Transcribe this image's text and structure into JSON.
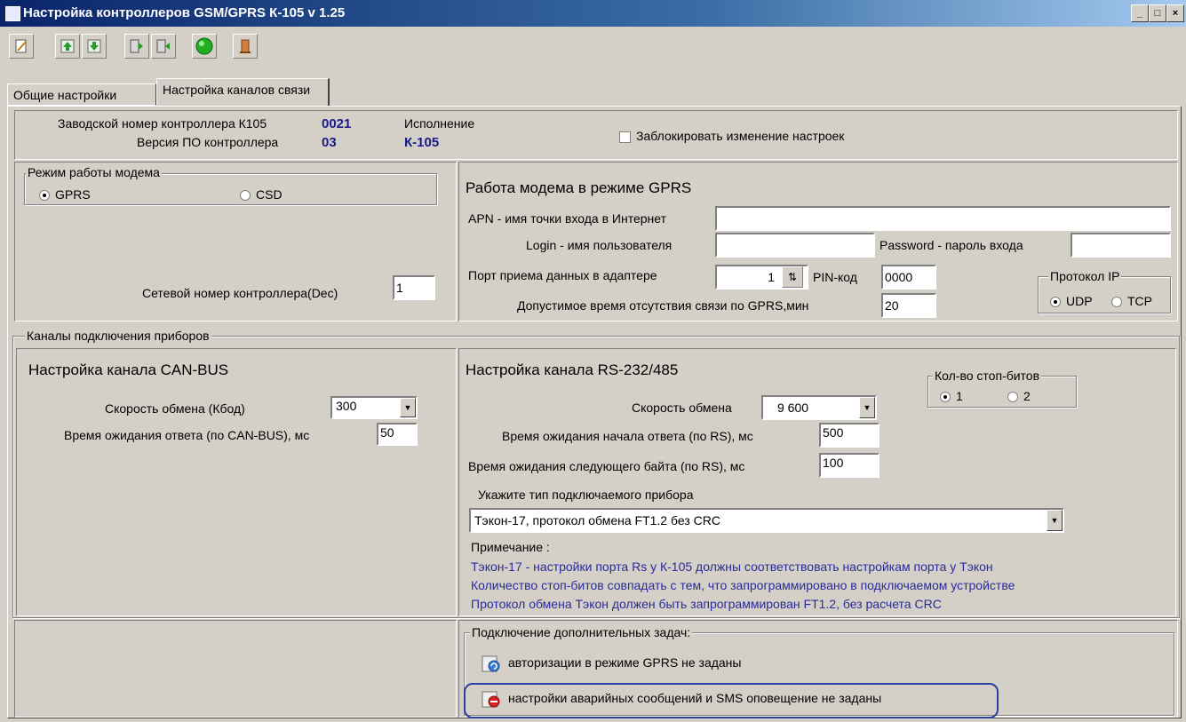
{
  "window": {
    "title": "Настройка контроллеров GSM/GPRS К-105   v 1.25",
    "buttons": [
      "_",
      "□",
      "×"
    ]
  },
  "toolbar": {
    "icons": [
      "edit-icon",
      "arrow-up-icon",
      "arrow-down-icon",
      "read-device-icon",
      "write-device-icon",
      "connect-status-icon",
      "exit-icon"
    ]
  },
  "tabs": [
    {
      "label": "Общие настройки",
      "active": false
    },
    {
      "label": "Настройка каналов связи",
      "active": true
    }
  ],
  "header": {
    "serial_label": "Заводской номер контроллера К105",
    "serial_value": "0021",
    "fw_label": "Версия ПО контроллера",
    "fw_value": "03",
    "variant_label": "Исполнение",
    "variant_value": "К-105",
    "lock_label": "Заблокировать изменение настроек",
    "lock_checked": false
  },
  "modem_mode": {
    "group_label": "Режим работы модема",
    "options": [
      "GPRS",
      "CSD"
    ],
    "selected": "GPRS",
    "net_number_label": "Сетевой номер контроллера(Dec)",
    "net_number_value": "1"
  },
  "gprs": {
    "title": "Работа модема в режиме GPRS",
    "apn_label": "APN - имя точки входа в Интернет",
    "apn_value": "",
    "login_label": "Login - имя пользователя",
    "login_value": "",
    "password_label": "Password  - пароль входа",
    "password_value": "",
    "port_label": "Порт приема данных в адаптере",
    "port_value": "1",
    "pin_label": "PIN-код",
    "pin_value": "0000",
    "timeout_label": "Допустимое время отсутствия связи по GPRS,мин",
    "timeout_value": "20",
    "protocol_group_label": "Протокол IP",
    "protocol_options": [
      "UDP",
      "TCP"
    ],
    "protocol_selected": "UDP"
  },
  "channels": {
    "group_label": "Каналы подключения приборов",
    "can": {
      "title": "Настройка  канала CAN-BUS",
      "speed_label": "Скорость обмена (Кбод)",
      "speed_value": "300",
      "timeout_label": "Время ожидания ответа (по CAN-BUS), мс",
      "timeout_value": "50"
    },
    "rs": {
      "title": "Настройка канала RS-232/485",
      "stopbits_group_label": "Кол-во стоп-битов",
      "stopbits_options": [
        "1",
        "2"
      ],
      "stopbits_selected": "1",
      "speed_label": "Скорость обмена",
      "speed_value": "9 600",
      "start_timeout_label": "Время ожидания начала ответа (по RS), мс",
      "start_timeout_value": "500",
      "byte_timeout_label": "Время ожидания следующего байта (по RS), мс",
      "byte_timeout_value": "100",
      "device_type_label": "Укажите тип подключаемого прибора",
      "device_type_value": "Тэкон-17, протокол обмена FT1.2 без CRC",
      "note_label": "Примечание :",
      "notes": [
        "Тэкон-17 - настройки порта Rs у К-105 должны соответствовать настройкам порта у Тэкон",
        "Количество стоп-битов совпадать с тем, что запрограммировано в подключаемом устройстве",
        "Протокол обмена Тэкон должен быть запрограммирован FT1.2, без расчета CRC"
      ]
    }
  },
  "extra_tasks": {
    "group_label": "Подключение дополнительных задач:",
    "auth_label": "авторизации в режиме GPRS не заданы",
    "alarm_label": "настройки аварийных сообщений и SMS оповещение не заданы",
    "highlight_color": "#2a3fa0"
  },
  "colors": {
    "title_bar": "#0a246a",
    "value_text": "#1a1a8a",
    "note_text": "#2a2a9a",
    "window_bg": "#d4d0c8"
  }
}
